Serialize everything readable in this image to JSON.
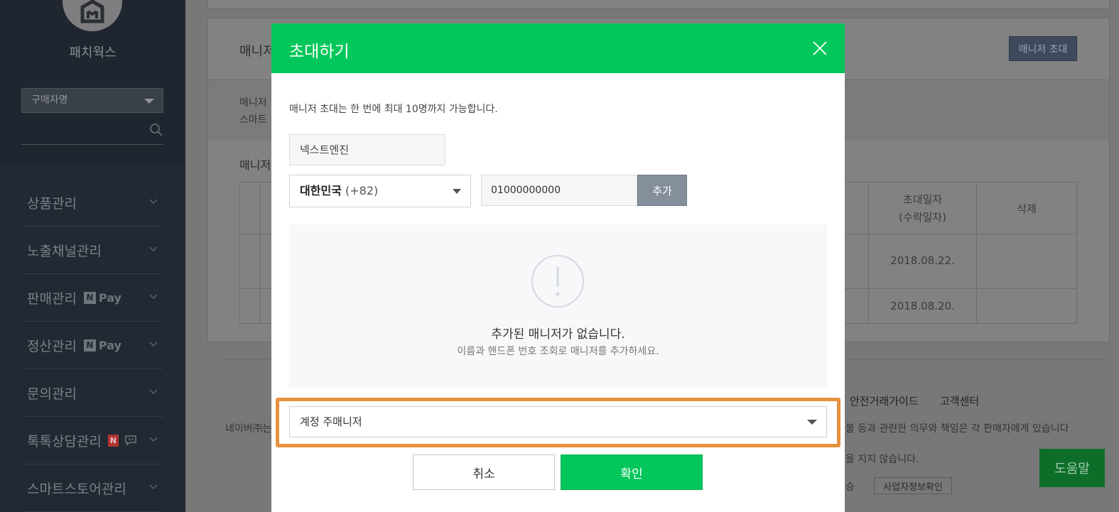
{
  "sidebar": {
    "store_name": "패치웍스",
    "filter_select": "구매자명",
    "menu": [
      {
        "label": "상품관리"
      },
      {
        "label": "노출채널관리"
      },
      {
        "label": "판매관리",
        "badge": "Pay"
      },
      {
        "label": "정산관리",
        "badge": "Pay"
      },
      {
        "label": "문의관리"
      },
      {
        "label": "톡톡상담관리",
        "badge": "N"
      },
      {
        "label": "스마트스토어관리"
      }
    ]
  },
  "background": {
    "section_title": "매니저",
    "info_line1": "매니저",
    "info_line2": "스마트",
    "list_title": "매니저",
    "invite_button": "매니저 초대",
    "table": {
      "col_invite_date_line1": "초대일자",
      "col_invite_date_line2": "(수락일자)",
      "col_delete": "삭제",
      "rows": [
        {
          "date": "2018.08.22."
        },
        {
          "date": "2018.08.20."
        }
      ]
    },
    "footer_links": [
      "안전거래가이드",
      "고객센터"
    ],
    "footer_text1": "네이버㈜는",
    "footer_text2": "불 등과 관련한 의무와 책임은 각 판매자에게 있습니다",
    "footer_text3": "을 지지 않습니다.",
    "footer_text4": "승",
    "biz_info_button": "사업자정보확인",
    "help_button": "도움말"
  },
  "modal": {
    "title": "초대하기",
    "description": "매니저 초대는 한 번에 최대 10명까지 가능합니다.",
    "name_value": "넥스트엔진",
    "country_label": "대한민국",
    "country_code": "(+82)",
    "phone_value": "01000000000",
    "add_button": "추가",
    "empty_title": "추가된 매니저가 없습니다.",
    "empty_subtitle": "이름과 핸드폰 번호 조회로 매니저를 추가하세요.",
    "role_select": "계정 주매니저",
    "cancel_button": "취소",
    "confirm_button": "확인"
  },
  "colors": {
    "brand_green": "#03c75a",
    "highlight_orange": "#e8913f",
    "add_button_gray": "#858f9c"
  }
}
